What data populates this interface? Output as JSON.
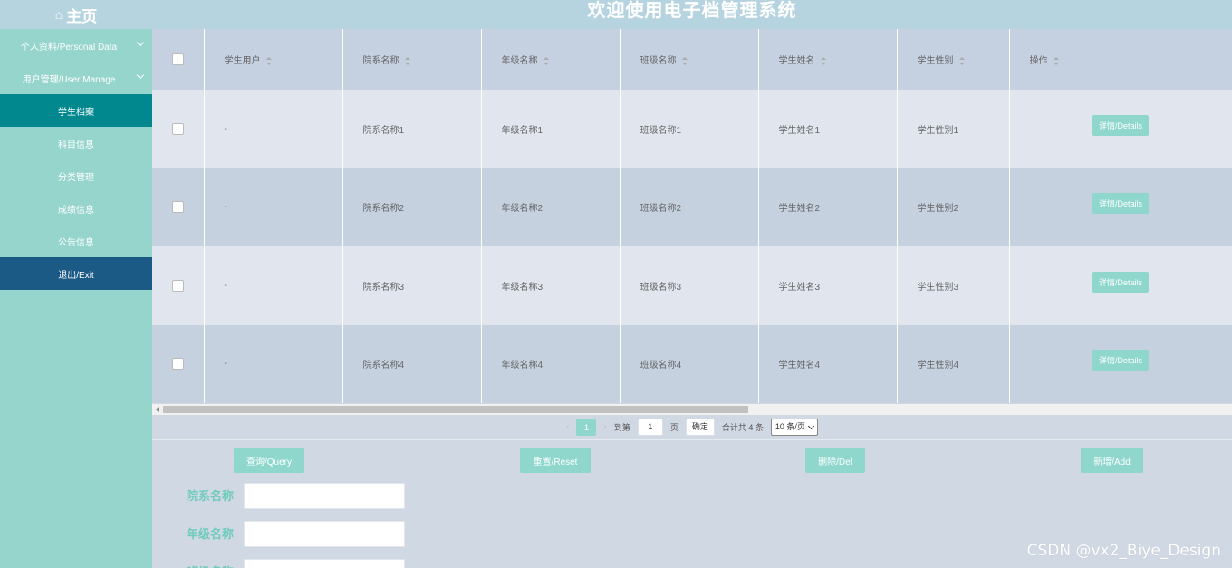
{
  "header": {
    "home_label": "主页",
    "title": "欢迎使用电子档管理系统"
  },
  "sidebar": {
    "groups": [
      {
        "label": "个人资料/Personal Data"
      },
      {
        "label": "用户管理/User Manage"
      }
    ],
    "items": [
      {
        "label": "学生档案",
        "active": true
      },
      {
        "label": "科目信息"
      },
      {
        "label": "分类管理"
      },
      {
        "label": "成绩信息"
      },
      {
        "label": "公告信息"
      },
      {
        "label": "退出/Exit"
      }
    ]
  },
  "table": {
    "columns": [
      "学生用户",
      "院系名称",
      "年级名称",
      "班级名称",
      "学生姓名",
      "学生性别",
      "操作"
    ],
    "rows": [
      {
        "user": "-",
        "dept": "院系名称1",
        "grade": "年级名称1",
        "class": "班级名称1",
        "name": "学生姓名1",
        "gender": "学生性别1",
        "action": "详情/Details"
      },
      {
        "user": "-",
        "dept": "院系名称2",
        "grade": "年级名称2",
        "class": "班级名称2",
        "name": "学生姓名2",
        "gender": "学生性别2",
        "action": "详情/Details"
      },
      {
        "user": "-",
        "dept": "院系名称3",
        "grade": "年级名称3",
        "class": "班级名称3",
        "name": "学生姓名3",
        "gender": "学生性别3",
        "action": "详情/Details"
      },
      {
        "user": "-",
        "dept": "院系名称4",
        "grade": "年级名称4",
        "class": "班级名称4",
        "name": "学生姓名4",
        "gender": "学生性别4",
        "action": "详情/Details"
      }
    ]
  },
  "pagination": {
    "prev": "‹",
    "current": "1",
    "next": "›",
    "goto_label": "到第",
    "goto_value": "1",
    "page_unit": "页",
    "confirm": "确定",
    "total": "合计共 4 条",
    "page_size": "10 条/页"
  },
  "actions": {
    "query": "查询/Query",
    "reset": "重置/Reset",
    "delete": "删除/Del",
    "add": "新增/Add"
  },
  "search_form": {
    "fields": [
      {
        "label": "院系名称",
        "value": ""
      },
      {
        "label": "年级名称",
        "value": ""
      },
      {
        "label": "班级名称",
        "value": ""
      }
    ]
  },
  "watermark": "CSDN @vx2_Biye_Design",
  "colors": {
    "accent": "#8fd7cc",
    "sidebar": "#96d5cc",
    "active_item": "#00888e",
    "exit_item": "#1c5a86",
    "header": "#b6d4df"
  }
}
